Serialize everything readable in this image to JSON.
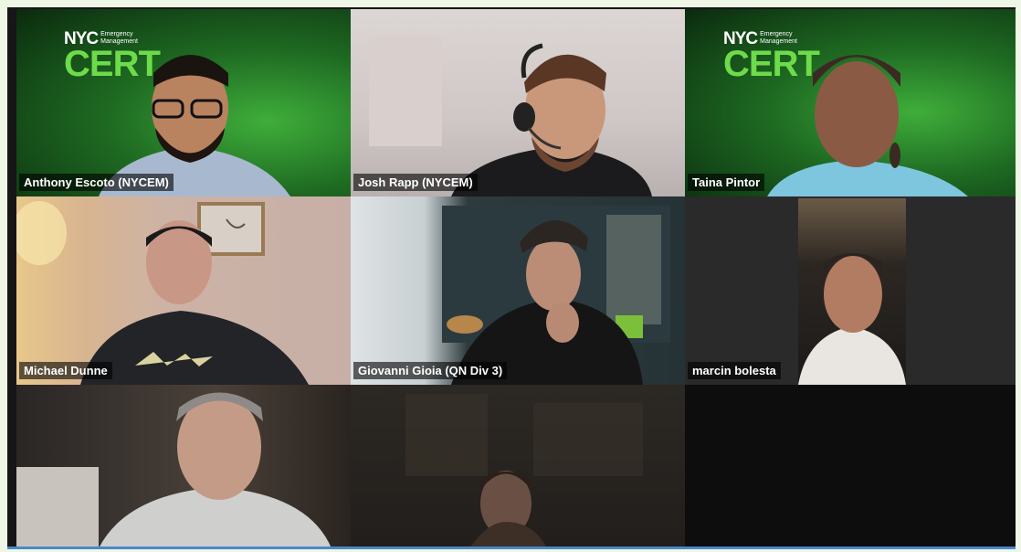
{
  "meeting": {
    "participants": [
      {
        "name": "Anthony Escoto (NYCEM)",
        "background": "cert"
      },
      {
        "name": "Josh Rapp (NYCEM)",
        "background": "room"
      },
      {
        "name": "Taina Pintor",
        "background": "cert"
      },
      {
        "name": "Michael Dunne",
        "background": "room"
      },
      {
        "name": "Giovanni Gioia (QN Div 3)",
        "background": "room"
      },
      {
        "name": "marcin bolesta",
        "background": "room"
      },
      {
        "name": "",
        "background": "room"
      },
      {
        "name": "",
        "background": "dark"
      }
    ],
    "logo": {
      "nyc": "NYC",
      "line1": "Emergency",
      "line2": "Management",
      "cert": "CERT"
    }
  },
  "colors": {
    "cert_green": "#6ddb4a",
    "frame": "#eef6e6",
    "stage": "#161616"
  }
}
